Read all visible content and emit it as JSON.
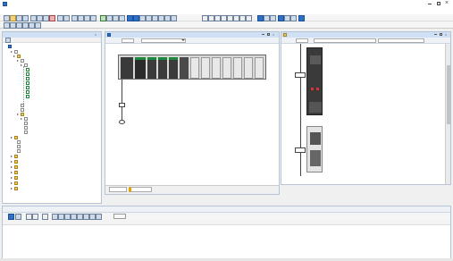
{
  "window": {
    "title": "",
    "controls": [
      "minimize-icon",
      "maximize-icon",
      "close-icon"
    ]
  },
  "menu": {
    "items": [
      "",
      "",
      "",
      "",
      "",
      "",
      "",
      "",
      "",
      "",
      ""
    ]
  },
  "left_panel": {
    "title": "",
    "tree": [
      "",
      "",
      "",
      "",
      "",
      "",
      "",
      "",
      "",
      "",
      "",
      "",
      "",
      "",
      "",
      "",
      "",
      "",
      "",
      "",
      "",
      "",
      "",
      "",
      "",
      "",
      "",
      "",
      "",
      ""
    ]
  },
  "center_panel": {
    "title": "",
    "tabs": [
      "",
      ""
    ],
    "bus_label": ""
  },
  "right_panel": {
    "title": "",
    "header_fields": [
      "",
      "",
      ""
    ]
  },
  "bottom_panel": {
    "tabs": [
      "",
      ""
    ],
    "filter_button": "",
    "columns": [
      "",
      "",
      "",
      "",
      "",
      "",
      ""
    ]
  },
  "colors": {
    "accent": "#2f6fc4",
    "panel_header": "#cfe0f5",
    "selection": "#c5d9f1",
    "tree_green": "#1c8a3a"
  }
}
